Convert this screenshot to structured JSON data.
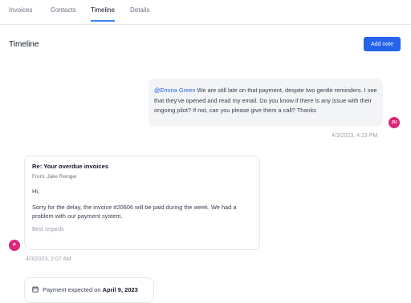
{
  "tabs": [
    {
      "label": "Invoices",
      "active": false
    },
    {
      "label": "Contacts",
      "active": false
    },
    {
      "label": "Timeline",
      "active": true
    },
    {
      "label": "Details",
      "active": false
    }
  ],
  "header": {
    "title": "Timeline",
    "add_note_label": "Add note"
  },
  "note": {
    "mention": "@Emma Green",
    "text": " We are still late on that payment, despite two gentle reminders. I see that they've opened and read my email. Do you know if there is any issue with their ongoing pilot? If not, can you please give them a call? Thanks",
    "avatar_initials": "JU",
    "timestamp": "4/3/2023, 4:23 PM"
  },
  "email": {
    "subject": "Re: Your overdue invoices",
    "from": "From: Jake Reinger",
    "greeting": "Hi,",
    "body": "Sorry for the delay, the invoice #20606 will be paid during the week. We had a problem with our payment system.",
    "signoff": "Best regards",
    "avatar_initials": "P",
    "timestamp": "4/3/2023, 2:07 AM"
  },
  "payment": {
    "prefix": "Payment expected on ",
    "date": "April 9, 2023"
  },
  "colors": {
    "accent": "#2563eb",
    "avatar": "#db2777"
  }
}
